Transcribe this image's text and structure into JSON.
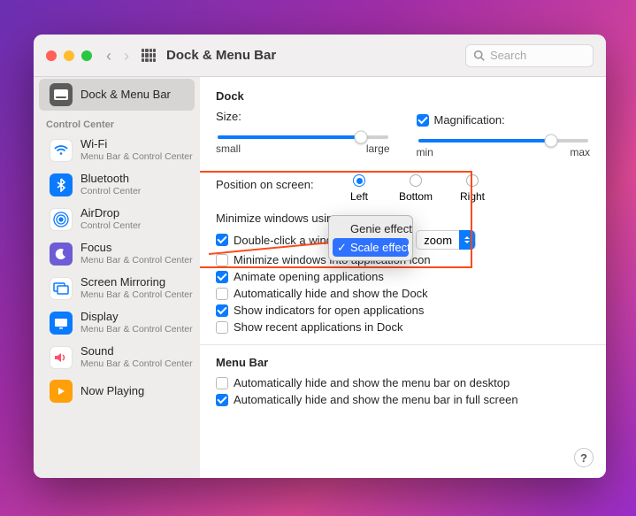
{
  "window": {
    "title": "Dock & Menu Bar",
    "search_placeholder": "Search"
  },
  "sidebar": {
    "control_center_header": "Control Center",
    "items": [
      {
        "title": "Dock & Menu Bar",
        "subtitle": ""
      },
      {
        "title": "Wi-Fi",
        "subtitle": "Menu Bar & Control Center"
      },
      {
        "title": "Bluetooth",
        "subtitle": "Control Center"
      },
      {
        "title": "AirDrop",
        "subtitle": "Control Center"
      },
      {
        "title": "Focus",
        "subtitle": "Menu Bar & Control Center"
      },
      {
        "title": "Screen Mirroring",
        "subtitle": "Menu Bar & Control Center"
      },
      {
        "title": "Display",
        "subtitle": "Menu Bar & Control Center"
      },
      {
        "title": "Sound",
        "subtitle": "Menu Bar & Control Center"
      },
      {
        "title": "Now Playing",
        "subtitle": ""
      }
    ]
  },
  "dock": {
    "section_title": "Dock",
    "size_label": "Size:",
    "size_min": "small",
    "size_max": "large",
    "magnification_label": "Magnification:",
    "mag_min": "min",
    "mag_max": "max",
    "position_label": "Position on screen:",
    "position_options": {
      "left": "Left",
      "bottom": "Bottom",
      "right": "Right"
    },
    "minimize_label": "Minimize windows using",
    "minimize_menu": {
      "genie": "Genie effect",
      "scale": "Scale effect"
    },
    "doubleclick_label": "Double-click a window's title bar to",
    "doubleclick_value": "zoom",
    "check_minimize_into_app": "Minimize windows into application icon",
    "check_animate": "Animate opening applications",
    "check_autohide_dock": "Automatically hide and show the Dock",
    "check_indicators": "Show indicators for open applications",
    "check_recent": "Show recent applications in Dock"
  },
  "menubar": {
    "section_title": "Menu Bar",
    "check_autohide_desktop": "Automatically hide and show the menu bar on desktop",
    "check_autohide_fullscreen": "Automatically hide and show the menu bar in full screen"
  },
  "help": "?"
}
